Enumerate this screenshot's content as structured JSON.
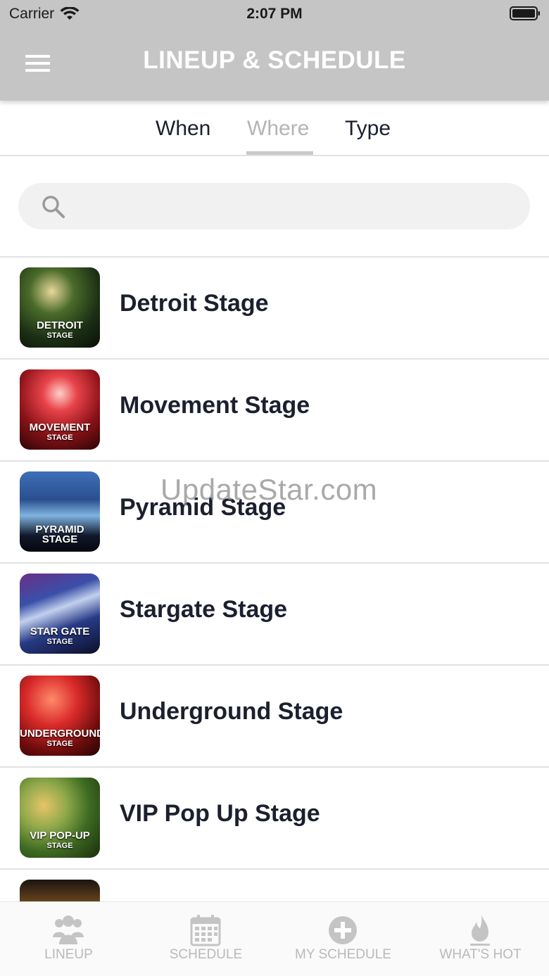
{
  "status_bar": {
    "carrier": "Carrier",
    "time": "2:07 PM"
  },
  "header": {
    "title": "LINEUP & SCHEDULE"
  },
  "tabs": [
    {
      "label": "When"
    },
    {
      "label": "Where",
      "active": true
    },
    {
      "label": "Type"
    }
  ],
  "search": {
    "placeholder": ""
  },
  "stages": [
    {
      "name": "Detroit Stage",
      "thumb_caption": "DETROIT",
      "thumb_sub": "STAGE"
    },
    {
      "name": "Movement Stage",
      "thumb_caption": "MOVEMENT",
      "thumb_sub": "STAGE"
    },
    {
      "name": "Pyramid Stage",
      "thumb_caption": "PYRAMID STAGE",
      "thumb_sub": ""
    },
    {
      "name": "Stargate Stage",
      "thumb_caption": "STAR GATE",
      "thumb_sub": "STAGE"
    },
    {
      "name": "Underground Stage",
      "thumb_caption": "UNDERGROUND",
      "thumb_sub": "STAGE"
    },
    {
      "name": "VIP Pop Up Stage",
      "thumb_caption": "VIP POP-UP",
      "thumb_sub": "STAGE"
    }
  ],
  "watermark": "UpdateStar.com",
  "bottom_nav": [
    {
      "label": "LINEUP",
      "icon": "people-icon"
    },
    {
      "label": "SCHEDULE",
      "icon": "calendar-icon"
    },
    {
      "label": "MY SCHEDULE",
      "icon": "plus-circle-icon"
    },
    {
      "label": "WHAT'S HOT",
      "icon": "flame-icon"
    }
  ],
  "colors": {
    "header_bg": "#c5c5c6",
    "text": "#1b1f2e",
    "inactive": "#b9b9b9"
  }
}
